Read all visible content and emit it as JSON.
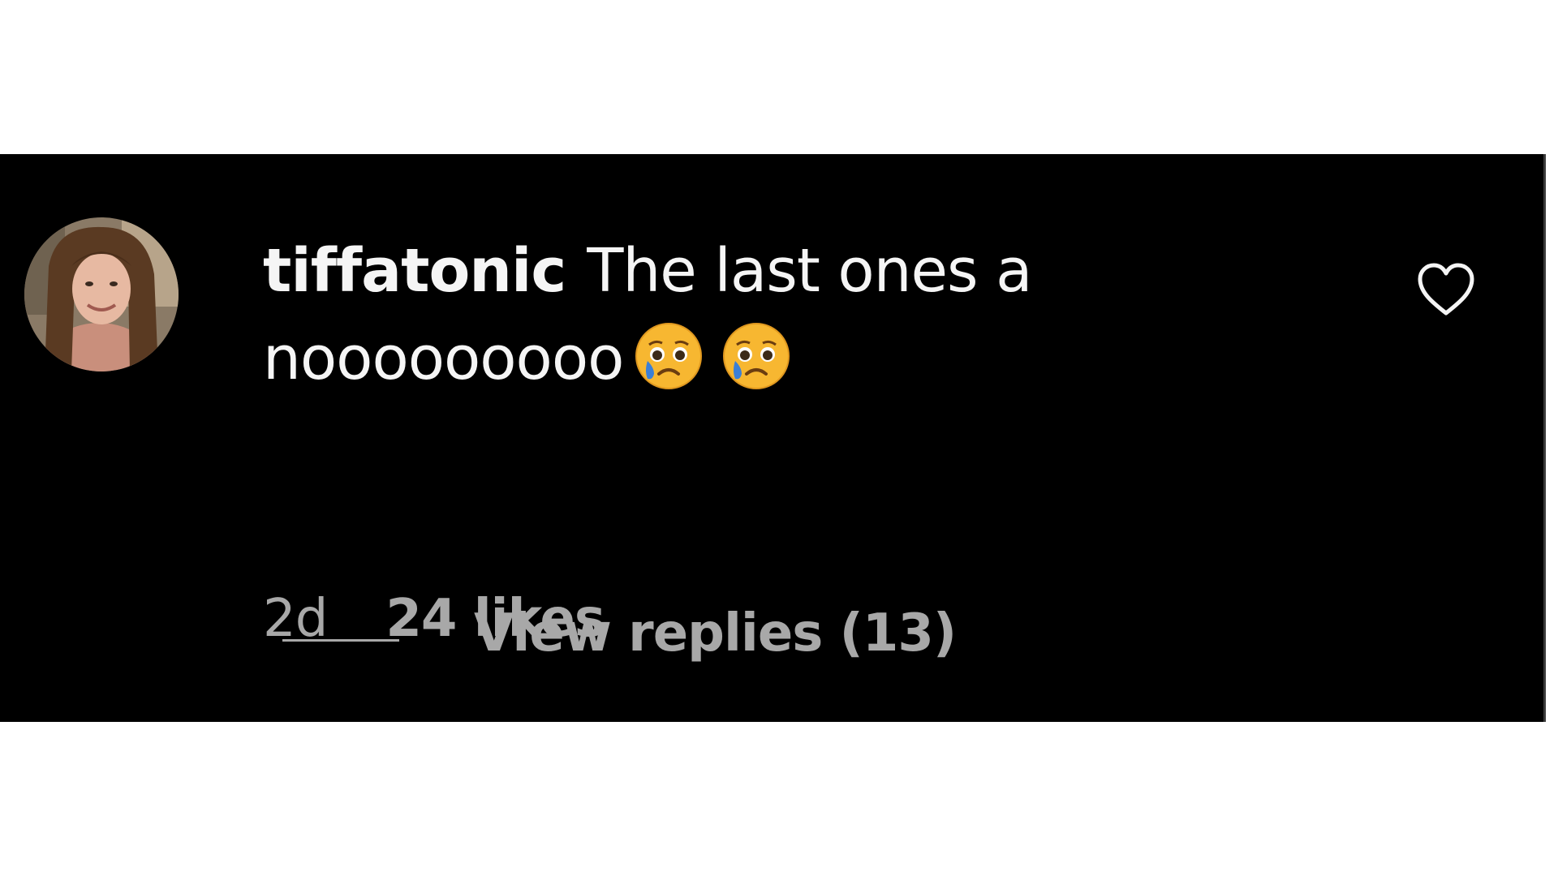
{
  "comment": {
    "username": "tiffatonic",
    "text": "The last ones a nooooooooo",
    "emojis": [
      "crying-face-icon",
      "crying-face-icon"
    ],
    "time": "2d",
    "likes": "24 likes",
    "view_replies": "View replies (13)"
  },
  "icons": {
    "like": "heart-outline-icon"
  },
  "colors": {
    "background": "#000000",
    "text": "#f5f5f5",
    "muted": "#a8a8a8",
    "emoji": "#f7b731"
  }
}
